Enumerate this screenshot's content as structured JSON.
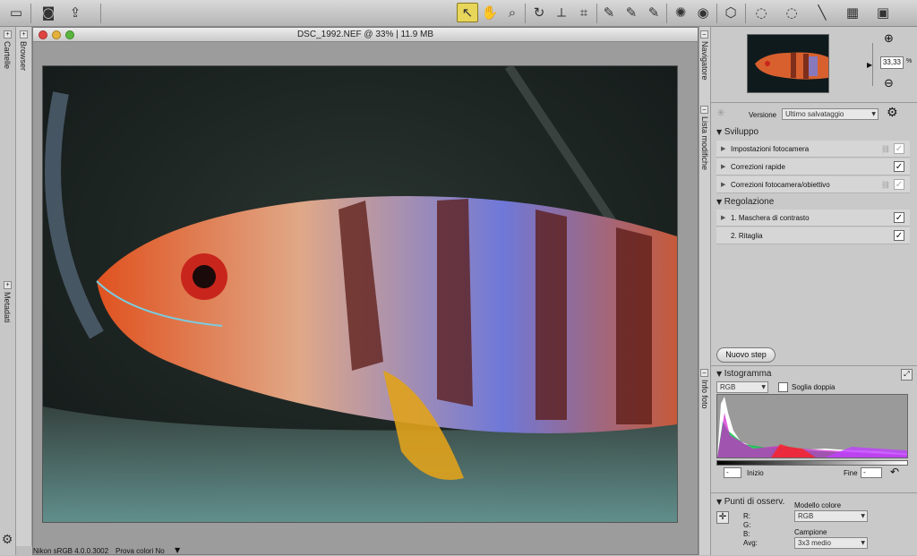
{
  "document": {
    "title": "DSC_1992.NEF @ 33% | 11.9 MB",
    "status_left": "Nikon sRGB 4.0.0.3002",
    "status_right": "Prova colori No"
  },
  "toolbar": {
    "tools": [
      {
        "name": "layout-icon",
        "glyph": "▭"
      },
      {
        "name": "camera-icon",
        "glyph": "◙"
      },
      {
        "name": "export-icon",
        "glyph": "⇪"
      },
      {
        "name": "pointer-tool-icon",
        "glyph": "↖",
        "active": true
      },
      {
        "name": "hand-tool-icon",
        "glyph": "✋"
      },
      {
        "name": "zoom-tool-icon",
        "glyph": "⌕"
      },
      {
        "name": "rotate-icon",
        "glyph": "↻"
      },
      {
        "name": "straighten-icon",
        "glyph": "⟂"
      },
      {
        "name": "crop-icon",
        "glyph": "⌗"
      },
      {
        "name": "eyedropper-black-icon",
        "glyph": "✎"
      },
      {
        "name": "eyedropper-gray-icon",
        "glyph": "✎"
      },
      {
        "name": "eyedropper-white-icon",
        "glyph": "✎"
      },
      {
        "name": "retouch-icon",
        "glyph": "✺"
      },
      {
        "name": "redeye-icon",
        "glyph": "◉"
      },
      {
        "name": "color-point-icon",
        "glyph": "⬡"
      },
      {
        "name": "selection-brush-icon",
        "glyph": "◌"
      },
      {
        "name": "lasso-icon",
        "glyph": "◌"
      },
      {
        "name": "gradient-line-icon",
        "glyph": "╲"
      },
      {
        "name": "gradient-fill-icon",
        "glyph": "▦"
      },
      {
        "name": "fill-icon",
        "glyph": "▣"
      }
    ]
  },
  "left_strip": {
    "folders_label": "Cartelle",
    "metadata_label": "Metadati",
    "browser_label": "Browser"
  },
  "right_strip": {
    "navigator_label": "Navigatore",
    "edit_list_label": "Lista modifiche",
    "photo_info_label": "Info foto"
  },
  "navigator": {
    "zoom_value": "33,33",
    "zoom_unit": "%"
  },
  "edit_list": {
    "version_label": "Versione",
    "version_value": "Ultimo salvataggio",
    "sections": [
      {
        "title": "Sviluppo",
        "items": [
          {
            "label": "Impostazioni fotocamera",
            "checked": false,
            "dim": true
          },
          {
            "label": "Correzioni rapide",
            "checked": true,
            "dim": false
          },
          {
            "label": "Correzioni fotocamera/obiettivo",
            "checked": false,
            "dim": true
          }
        ]
      },
      {
        "title": "Regolazione",
        "items": [
          {
            "label": "1. Maschera di contrasto",
            "checked": true,
            "dim": false
          },
          {
            "label": "2. Ritaglia",
            "checked": true,
            "dim": false
          }
        ]
      }
    ],
    "new_step_button": "Nuovo step"
  },
  "histogram": {
    "title": "Istogramma",
    "channel": "RGB",
    "double_threshold_label": "Soglia doppia",
    "start_label": "Inizio",
    "start_value": "-",
    "end_label": "Fine",
    "end_value": "-"
  },
  "watch_points": {
    "title": "Punti di osserv.",
    "r_label": "R:",
    "g_label": "G:",
    "b_label": "B:",
    "avg_label": "Avg:",
    "color_model_label": "Modello colore",
    "color_model_value": "RGB",
    "sample_label": "Campione",
    "sample_value": "3x3 medio"
  }
}
